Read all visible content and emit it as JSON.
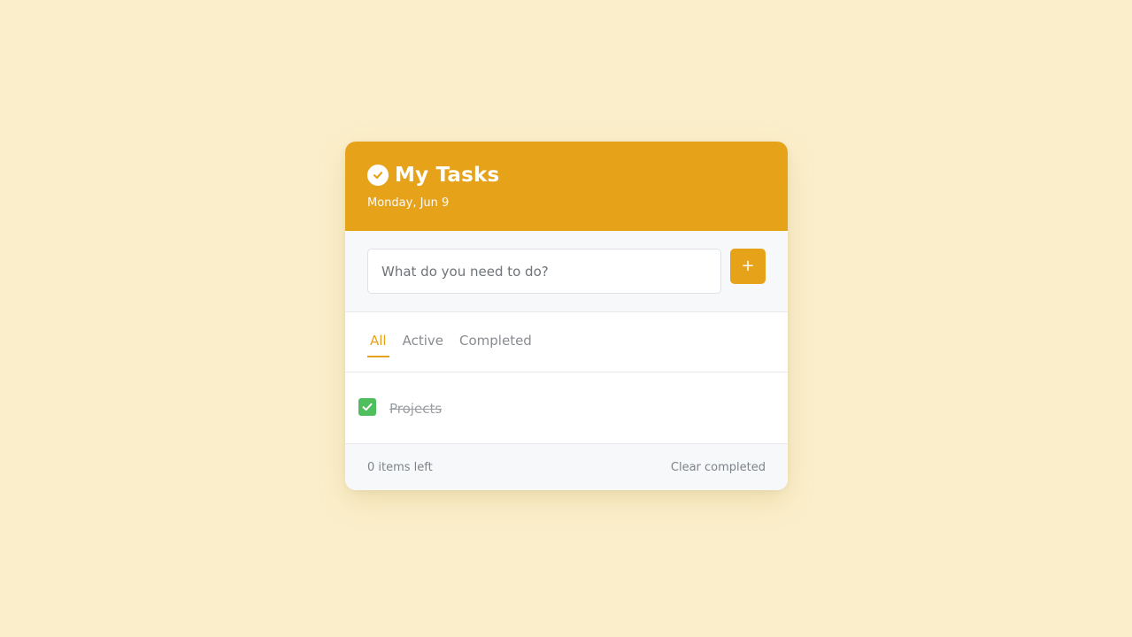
{
  "header": {
    "title": "My Tasks",
    "date": "Monday, Jun 9",
    "icon": "check-circle-icon"
  },
  "input": {
    "placeholder": "What do you need to do?",
    "value": "",
    "add_label": "+"
  },
  "filters": [
    {
      "label": "All",
      "active": true
    },
    {
      "label": "Active",
      "active": false
    },
    {
      "label": "Completed",
      "active": false
    }
  ],
  "tasks": [
    {
      "text": "Projects",
      "completed": true
    }
  ],
  "footer": {
    "items_left": "0 items left",
    "clear_label": "Clear completed"
  },
  "colors": {
    "accent": "#e6a31a",
    "background": "#fbefcb",
    "check": "#4fbf5e"
  }
}
